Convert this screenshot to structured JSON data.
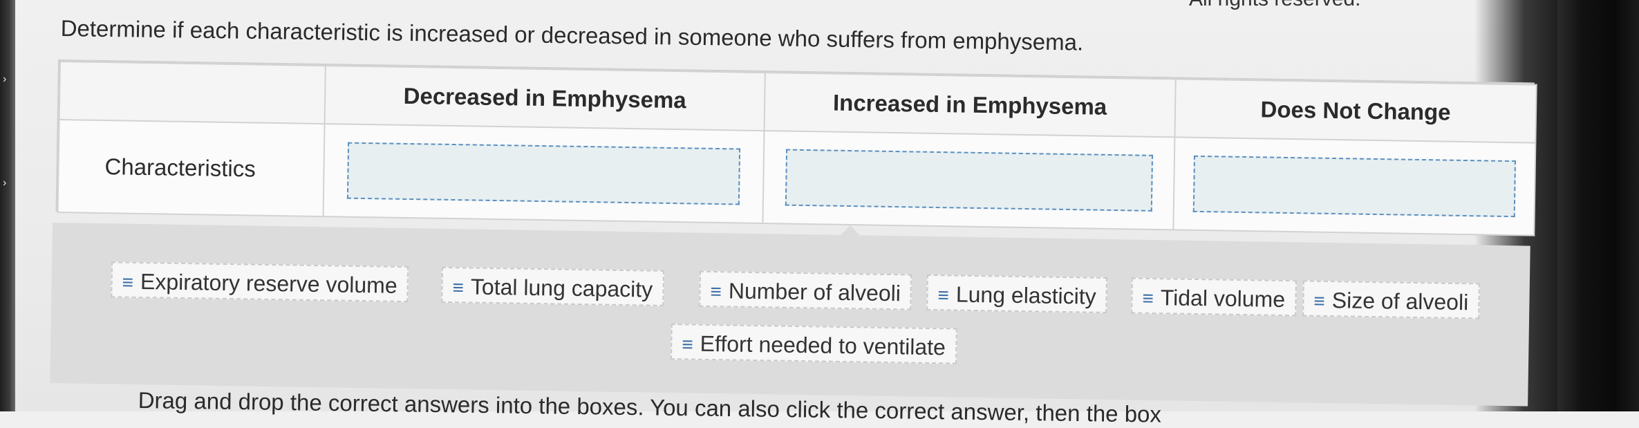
{
  "header": {
    "copyright": "Ali rights reserved.",
    "instruction": "Determine if each characteristic is increased or decreased in someone who suffers from emphysema."
  },
  "table": {
    "columns": [
      "",
      "Decreased in Emphysema",
      "Increased in Emphysema",
      "Does Not Change"
    ],
    "row_label": "Characteristics"
  },
  "answer_bank": {
    "items": [
      "Expiratory reserve volume",
      "Total lung capacity",
      "Number of alveoli",
      "Lung elasticity",
      "Tidal volume",
      "Size of alveoli",
      "Effort needed to ventilate"
    ],
    "grip_icon": "≡"
  },
  "footer": {
    "hint": "Drag and drop the correct answers into the boxes. You can also click the correct answer, then the box"
  },
  "colors": {
    "drop_zone_border": "#5c8fc0",
    "drop_zone_fill": "#e7eff1",
    "bank_background": "#dcdcdc",
    "grip_icon": "#3c6ea8"
  }
}
